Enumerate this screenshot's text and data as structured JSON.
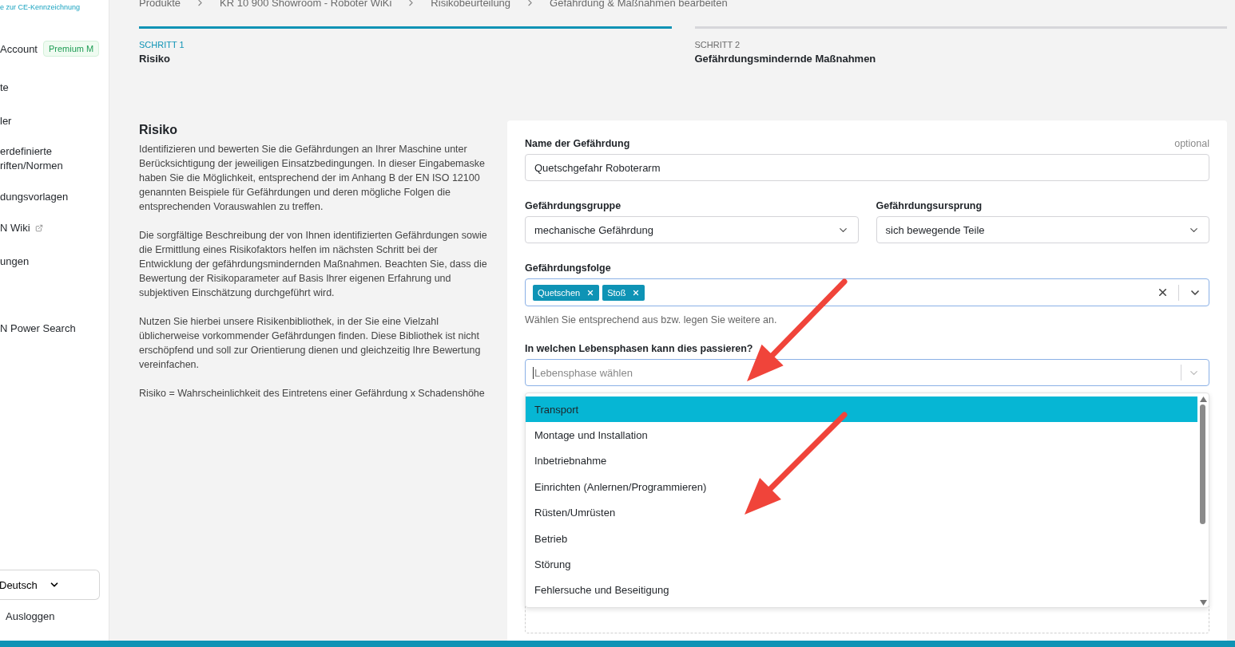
{
  "logo": {
    "tagline": "e zur CE-Kennzeichnung"
  },
  "sidebar": {
    "account": {
      "label": "Account",
      "badge": "Premium M"
    },
    "items": [
      {
        "label": "te",
        "external": false
      },
      {
        "label": "ler",
        "external": false
      },
      {
        "label": "erdefinierte\nriften/Normen",
        "external": false
      },
      {
        "label": "dungsvorlagen",
        "external": false
      },
      {
        "label": "N Wiki",
        "external": true
      },
      {
        "label": "ungen",
        "external": false
      },
      {
        "label": "N Power Search",
        "external": false
      }
    ],
    "language": "Deutsch",
    "logout": "Ausloggen"
  },
  "breadcrumb": [
    "Produkte",
    "KR 10 900 Showroom - Roboter WiKi",
    "Risikobeurteilung",
    "Gefährdung & Maßnahmen bearbeiten"
  ],
  "steps": [
    {
      "number": "SCHRITT 1",
      "title": "Risiko",
      "selected": true
    },
    {
      "number": "SCHRITT 2",
      "title": "Gefährdungsmindernde Maßnahmen",
      "selected": false
    }
  ],
  "intro": {
    "title": "Risiko",
    "paragraphs": [
      "Identifizieren und bewerten Sie die Gefährdungen an Ihrer Maschine unter Berücksichtigung der jeweiligen Einsatzbedingungen. In dieser Eingabemaske haben Sie die Möglichkeit, entsprechend der im Anhang B der EN ISO 12100 genannten Beispiele für Gefährdungen und deren mögliche Folgen die entsprechenden Vorauswahlen zu treffen.",
      "Die sorgfältige Beschreibung der von Ihnen identifizierten Gefährdungen sowie die Ermittlung eines Risikofaktors helfen im nächsten Schritt bei der Entwicklung der gefährdungsmindernden Maßnahmen. Beachten Sie, dass die Bewertung der Risikoparameter auf Basis Ihrer eigenen Erfahrung und subjektiven Einschätzung durchgeführt wird.",
      "Nutzen Sie hierbei unsere Risikenbibliothek, in der Sie eine Vielzahl üblicherweise vorkommender Gefährdungen finden. Diese Bibliothek ist nicht erschöpfend und soll zur Orientierung dienen und gleichzeitig Ihre Bewertung vereinfachen.",
      "Risiko = Wahrscheinlichkeit des Eintretens einer Gefährdung x Schadenshöhe"
    ]
  },
  "form": {
    "name": {
      "label": "Name der Gefährdung",
      "optional": "optional",
      "value": "Quetschgefahr Roboterarm"
    },
    "group": {
      "label": "Gefährdungsgruppe",
      "value": "mechanische Gefährdung"
    },
    "origin": {
      "label": "Gefährdungsursprung",
      "value": "sich bewegende Teile"
    },
    "consequence": {
      "label": "Gefährdungsfolge",
      "tags": [
        "Quetschen",
        "Stoß"
      ],
      "hint": "Wählen Sie entsprechend aus bzw. legen Sie weitere an."
    },
    "lifecycle": {
      "label": "In welchen Lebensphasen kann dies passieren?",
      "placeholder": "Lebensphase wählen",
      "expanded": true,
      "options": [
        {
          "label": "Transport",
          "selected": true
        },
        {
          "label": "Montage und Installation",
          "selected": false
        },
        {
          "label": "Inbetriebnahme",
          "selected": false
        },
        {
          "label": "Einrichten (Anlernen/Programmieren)",
          "selected": false
        },
        {
          "label": "Rüsten/Umrüsten",
          "selected": false
        },
        {
          "label": "Betrieb",
          "selected": false
        },
        {
          "label": "Störung",
          "selected": false
        },
        {
          "label": "Fehlersuche und Beseitigung",
          "selected": false
        }
      ]
    }
  },
  "annotations": [
    {
      "kind": "arrow"
    },
    {
      "kind": "arrow"
    }
  ]
}
